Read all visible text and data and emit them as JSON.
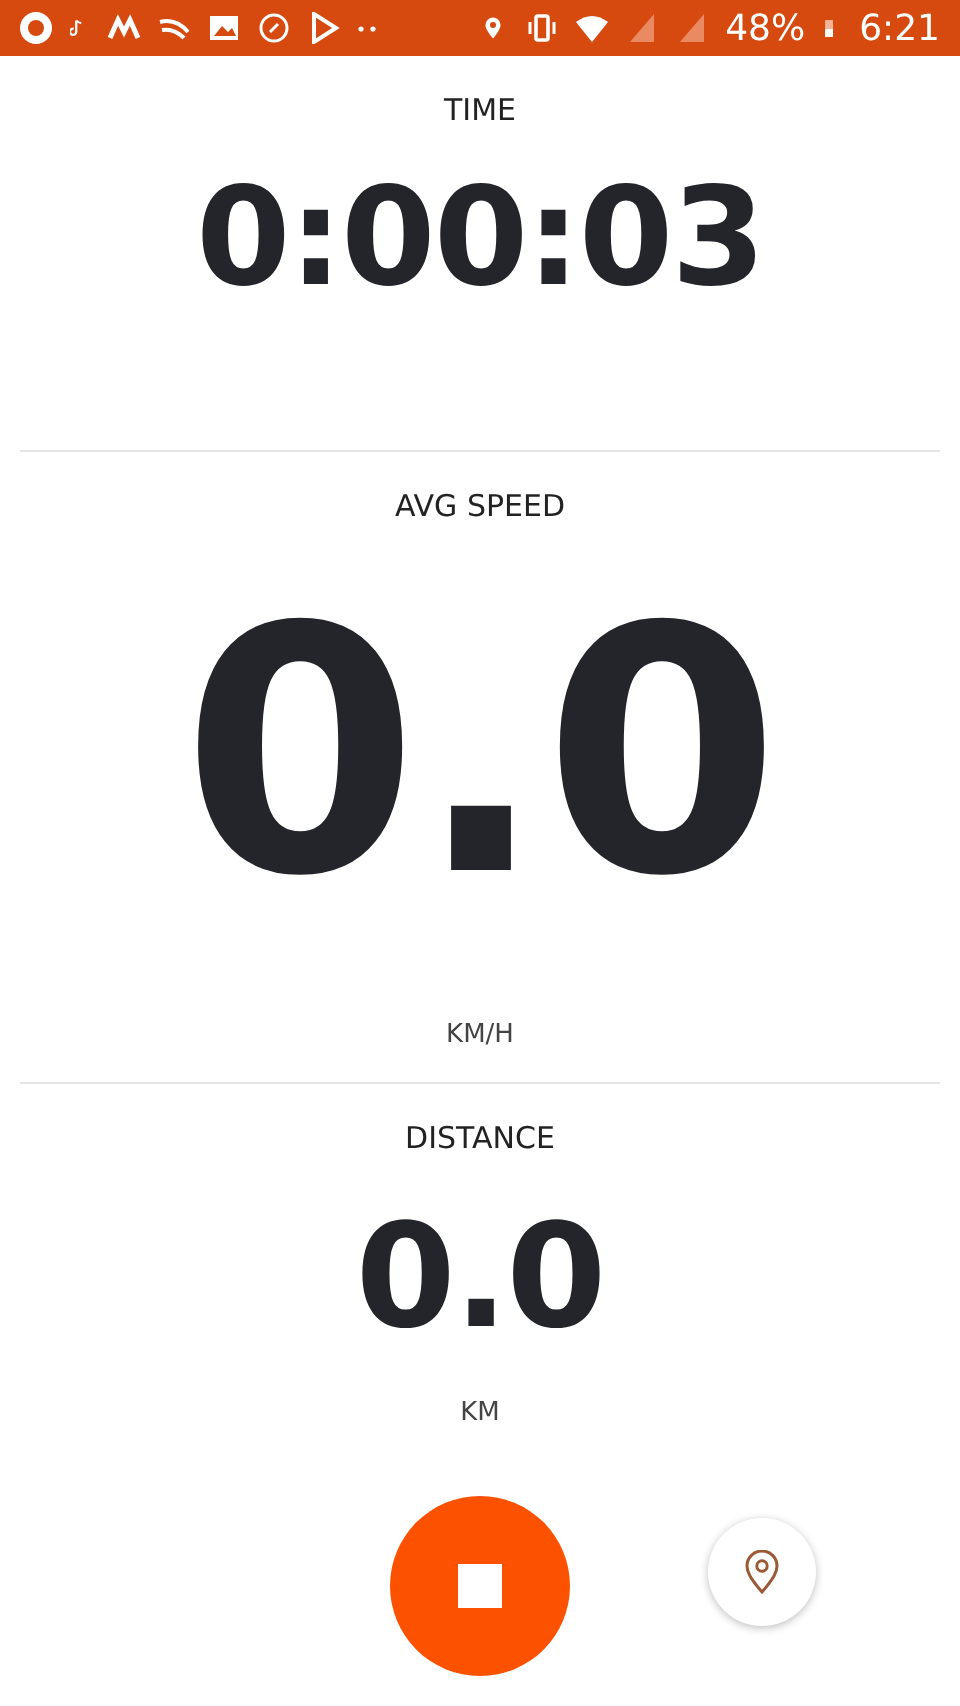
{
  "status_bar": {
    "battery": "48%",
    "time": "6:21"
  },
  "stats": [
    {
      "kind": "medium",
      "label": "TIME",
      "value": "0:00:03"
    },
    {
      "kind": "large",
      "label": "AVG SPEED",
      "value": "0.0",
      "unit": "KM/H"
    },
    {
      "kind": "small",
      "label": "DISTANCE",
      "value": "0.0",
      "unit": "KM"
    }
  ]
}
